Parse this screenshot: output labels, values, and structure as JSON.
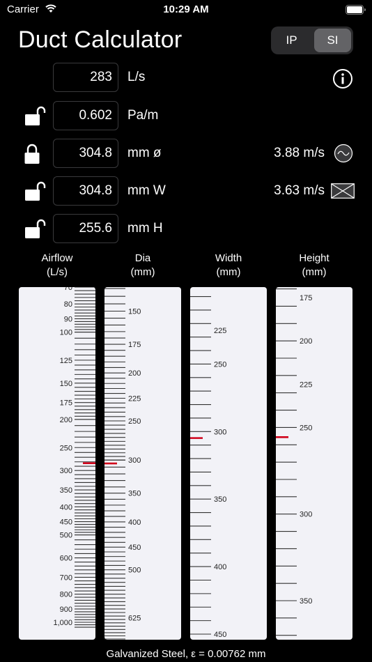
{
  "status_bar": {
    "carrier": "Carrier",
    "time": "10:29 AM"
  },
  "app": {
    "title": "Duct Calculator"
  },
  "units_toggle": {
    "options": [
      "IP",
      "SI"
    ],
    "selected": "SI"
  },
  "inputs": {
    "airflow": {
      "value": "283",
      "unit": "L/s"
    },
    "friction": {
      "value": "0.602",
      "unit": "Pa/m",
      "locked": false
    },
    "diameter": {
      "value": "304.8",
      "unit": "mm ø",
      "locked": true,
      "velocity": "3.88 m/s"
    },
    "width": {
      "value": "304.8",
      "unit": "mm W",
      "locked": false,
      "velocity": "3.63 m/s"
    },
    "height": {
      "value": "255.6",
      "unit": "mm H",
      "locked": false
    }
  },
  "columns": [
    {
      "label": "Airflow",
      "unit": "(L/s)"
    },
    {
      "label": "Dia",
      "unit": "(mm)"
    },
    {
      "label": "Width",
      "unit": "(mm)"
    },
    {
      "label": "Height",
      "unit": "(mm)"
    }
  ],
  "scales": {
    "airflow": {
      "labels": [
        "70",
        "80",
        "90",
        "100",
        "125",
        "150",
        "175",
        "200",
        "250",
        "300",
        "350",
        "400",
        "450",
        "500",
        "600",
        "700",
        "800",
        "900",
        "1,000"
      ],
      "current": 283
    },
    "dia": {
      "labels": [
        "150",
        "175",
        "200",
        "225",
        "250",
        "300",
        "350",
        "400",
        "450",
        "500",
        "625"
      ],
      "current": 304.8
    },
    "width": {
      "labels": [
        "225",
        "250",
        "300",
        "350",
        "400",
        "450"
      ],
      "current": 304.8
    },
    "height": {
      "labels": [
        "175",
        "200",
        "225",
        "250",
        "300",
        "350"
      ],
      "current": 255.6
    }
  },
  "footer": {
    "material": "Galvanized Steel, ε = 0.00762 mm"
  },
  "colors": {
    "marker": "#d0021b",
    "scale_bg": "#f2f2f7",
    "segment_active": "#636366"
  }
}
